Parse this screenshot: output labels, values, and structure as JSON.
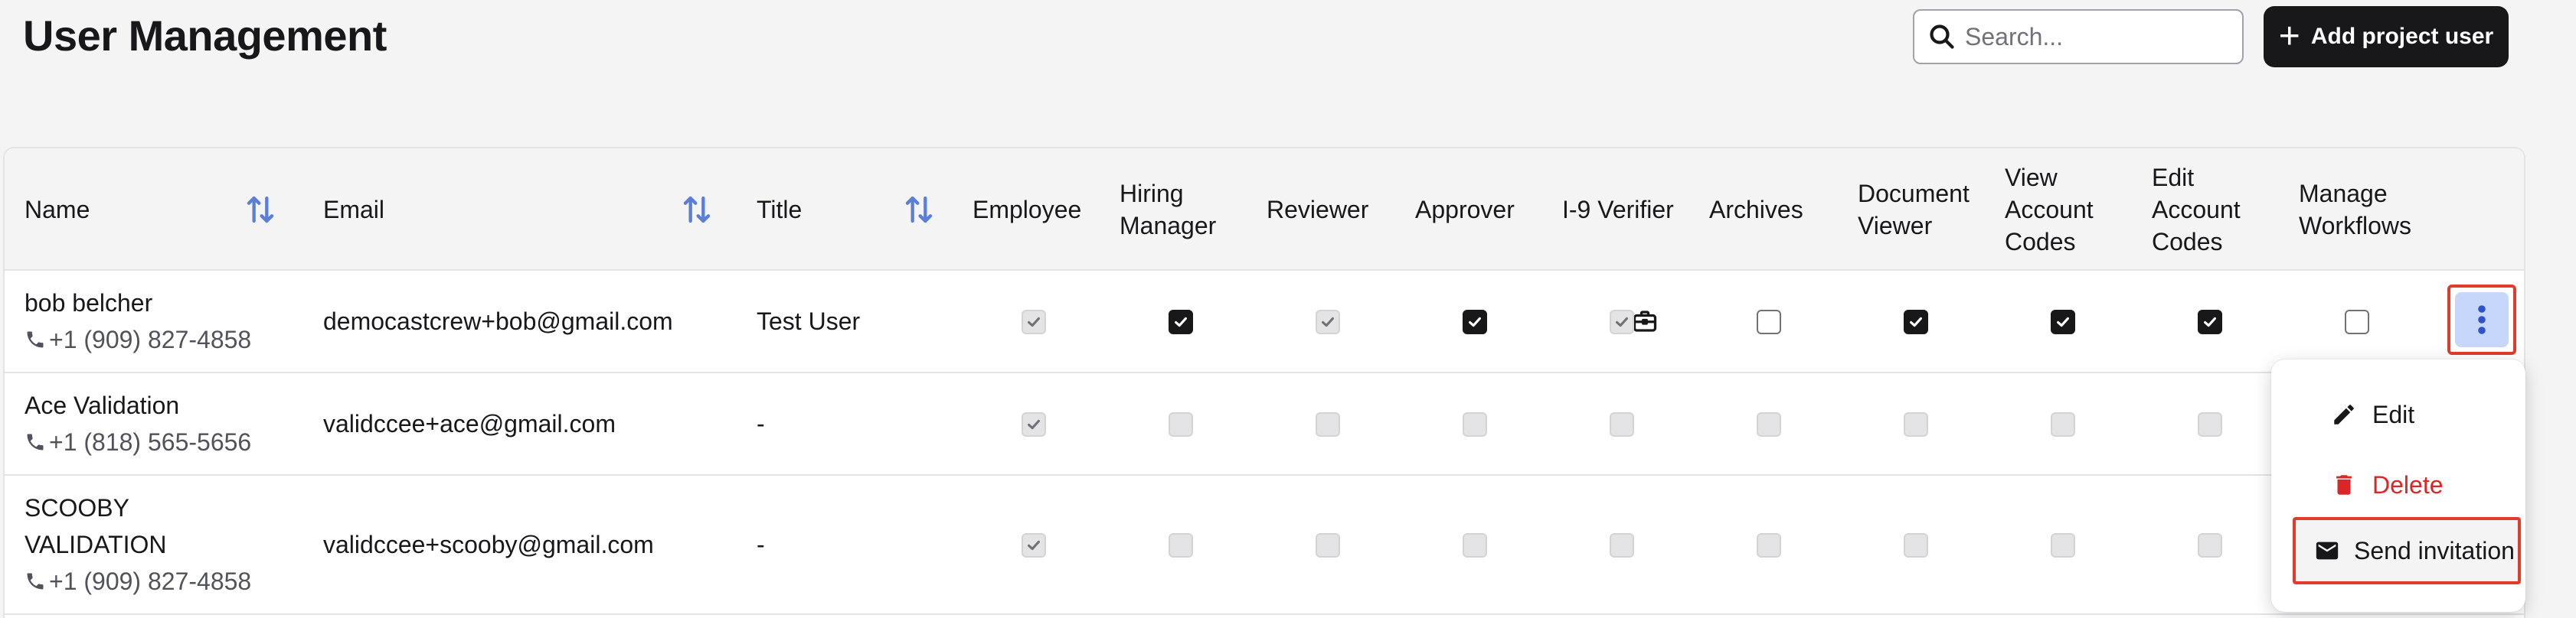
{
  "page": {
    "title": "User Management"
  },
  "search": {
    "placeholder": "Search..."
  },
  "add_button": {
    "label": "Add project user"
  },
  "table": {
    "columns": {
      "name": "Name",
      "email": "Email",
      "title": "Title",
      "employee": "Employee",
      "hiring_manager": "Hiring Manager",
      "reviewer": "Reviewer",
      "approver": "Approver",
      "i9_verifier": "I-9 Verifier",
      "archives": "Archives",
      "document_viewer": "Document Viewer",
      "view_account_codes": "View Account Codes",
      "edit_account_codes": "Edit Account Codes",
      "manage_workflows": "Manage Workflows"
    },
    "rows": [
      {
        "name": "bob belcher",
        "phone": "+1 (909) 827-4858",
        "email": "democastcrew+bob@gmail.com",
        "title": "Test User",
        "perms": [
          "disabled-checked",
          "checked",
          "disabled-checked",
          "checked",
          "disabled-checked",
          "empty",
          "checked",
          "checked",
          "checked",
          "empty"
        ]
      },
      {
        "name": "Ace Validation",
        "phone": "+1 (818) 565-5656",
        "email": "validccee+ace@gmail.com",
        "title": "-",
        "perms": [
          "disabled-checked",
          "disabled",
          "disabled",
          "disabled",
          "disabled",
          "disabled",
          "disabled",
          "disabled",
          "disabled",
          "disabled"
        ]
      },
      {
        "name_line1": "SCOOBY",
        "name_line2": "VALIDATION",
        "phone": "+1 (909) 827-4858",
        "email": "validccee+scooby@gmail.com",
        "title": "-",
        "perms": [
          "disabled-checked",
          "disabled",
          "disabled",
          "disabled",
          "disabled",
          "disabled",
          "disabled",
          "disabled",
          "disabled",
          "disabled"
        ]
      }
    ]
  },
  "context_menu": {
    "edit": "Edit",
    "delete": "Delete",
    "send_invitation": "Send invitation"
  },
  "colors": {
    "accent": "#18181b",
    "danger": "#dc2626",
    "sort_icon": "#5b7fd6",
    "kebab_bg": "#c7d7fb",
    "highlight": "#e23b2a"
  },
  "icons": {
    "search": "search-icon",
    "add": "plus-icon",
    "sort": "sort-arrows-icon",
    "phone": "phone-icon",
    "briefcase": "briefcase-icon",
    "more": "kebab-menu-icon",
    "edit": "pencil-icon",
    "delete": "trash-icon",
    "invite": "envelope-icon"
  }
}
